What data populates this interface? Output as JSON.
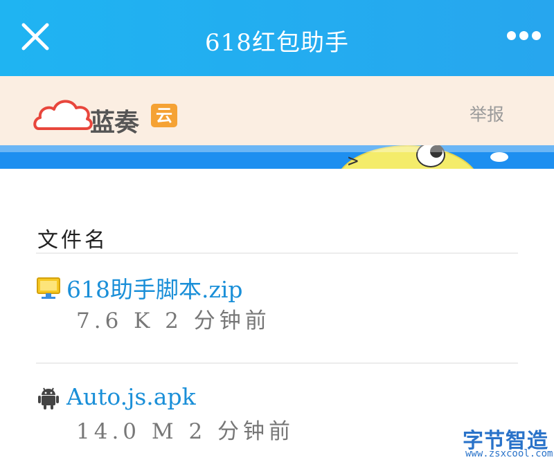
{
  "navbar": {
    "title": "618红包助手",
    "close_icon": "close-icon",
    "more_icon": "more-options-icon"
  },
  "site": {
    "logo_text": "蓝奏",
    "logo_badge": "云",
    "report_label": "举报"
  },
  "table": {
    "header": "文件名",
    "files": [
      {
        "name": "618助手脚本.zip",
        "meta": "7.6 K 2 分钟前",
        "icon": "zip-file-icon"
      },
      {
        "name": "Auto.js.apk",
        "meta": "14.0 M 2 分钟前",
        "icon": "android-icon"
      }
    ]
  },
  "watermark": {
    "main": "字节智造",
    "sub": "www.zsxcool.com"
  },
  "colors": {
    "navbar": "#1fb4f2",
    "header_bg": "#fbeee2",
    "link": "#1a8fd8",
    "watermark": "#2a73c9"
  }
}
